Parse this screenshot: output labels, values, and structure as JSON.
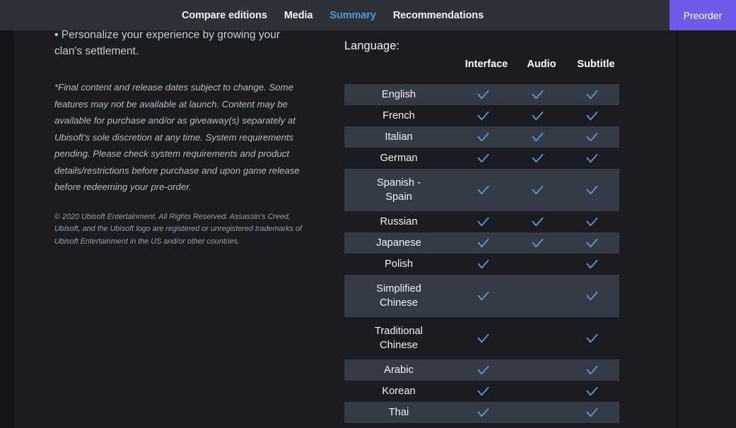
{
  "nav": {
    "items": [
      {
        "label": "Compare editions",
        "active": false
      },
      {
        "label": "Media",
        "active": false
      },
      {
        "label": "Summary",
        "active": true
      },
      {
        "label": "Recommendations",
        "active": false
      }
    ],
    "preorder_label": "Preorder",
    "active_color": "#4e9ad4",
    "bar_color": "#2e3138",
    "preorder_color": "#6c5ce7"
  },
  "left": {
    "bullet_line1": "• Personalize your experience by growing your",
    "bullet_line2": "clan's settlement.",
    "disclaimer": "*Final content and release dates subject to change. Some features may not be available at launch. Content may be available for purchase and/or as giveaway(s) separately at Ubisoft's sole discretion at any time. System requirements pending. Please check system requirements and product details/restrictions before purchase and upon game release before redeeming your pre-order.",
    "copyright": "© 2020 Ubisoft Entertainment. All Rights Reserved. Assassin's Creed, Ubisoft, and the Ubisoft logo are registered or unregistered trademarks of Ubisoft Entertainment in the US and/or other countries."
  },
  "language_table": {
    "title": "Language:",
    "columns": [
      "Interface",
      "Audio",
      "Subtitle"
    ],
    "check_color": "#5b9bd5",
    "stripe_color": "#353b46",
    "rows": [
      {
        "name": "English",
        "name2": "",
        "interface": true,
        "audio": true,
        "subtitle": true,
        "stripe": true,
        "tall": false
      },
      {
        "name": "French",
        "name2": "",
        "interface": true,
        "audio": true,
        "subtitle": true,
        "stripe": false,
        "tall": false
      },
      {
        "name": "Italian",
        "name2": "",
        "interface": true,
        "audio": true,
        "subtitle": true,
        "stripe": true,
        "tall": false
      },
      {
        "name": "German",
        "name2": "",
        "interface": true,
        "audio": true,
        "subtitle": true,
        "stripe": false,
        "tall": false
      },
      {
        "name": "Spanish -",
        "name2": "Spain",
        "interface": true,
        "audio": true,
        "subtitle": true,
        "stripe": true,
        "tall": true
      },
      {
        "name": "Russian",
        "name2": "",
        "interface": true,
        "audio": true,
        "subtitle": true,
        "stripe": false,
        "tall": false
      },
      {
        "name": "Japanese",
        "name2": "",
        "interface": true,
        "audio": true,
        "subtitle": true,
        "stripe": true,
        "tall": false
      },
      {
        "name": "Polish",
        "name2": "",
        "interface": true,
        "audio": false,
        "subtitle": true,
        "stripe": false,
        "tall": false
      },
      {
        "name": "Simplified",
        "name2": "Chinese",
        "interface": true,
        "audio": false,
        "subtitle": true,
        "stripe": true,
        "tall": true
      },
      {
        "name": "Traditional",
        "name2": "Chinese",
        "interface": true,
        "audio": false,
        "subtitle": true,
        "stripe": false,
        "tall": true
      },
      {
        "name": "Arabic",
        "name2": "",
        "interface": true,
        "audio": false,
        "subtitle": true,
        "stripe": true,
        "tall": false
      },
      {
        "name": "Korean",
        "name2": "",
        "interface": true,
        "audio": false,
        "subtitle": true,
        "stripe": false,
        "tall": false
      },
      {
        "name": "Thai",
        "name2": "",
        "interface": true,
        "audio": false,
        "subtitle": true,
        "stripe": true,
        "tall": false
      }
    ]
  }
}
